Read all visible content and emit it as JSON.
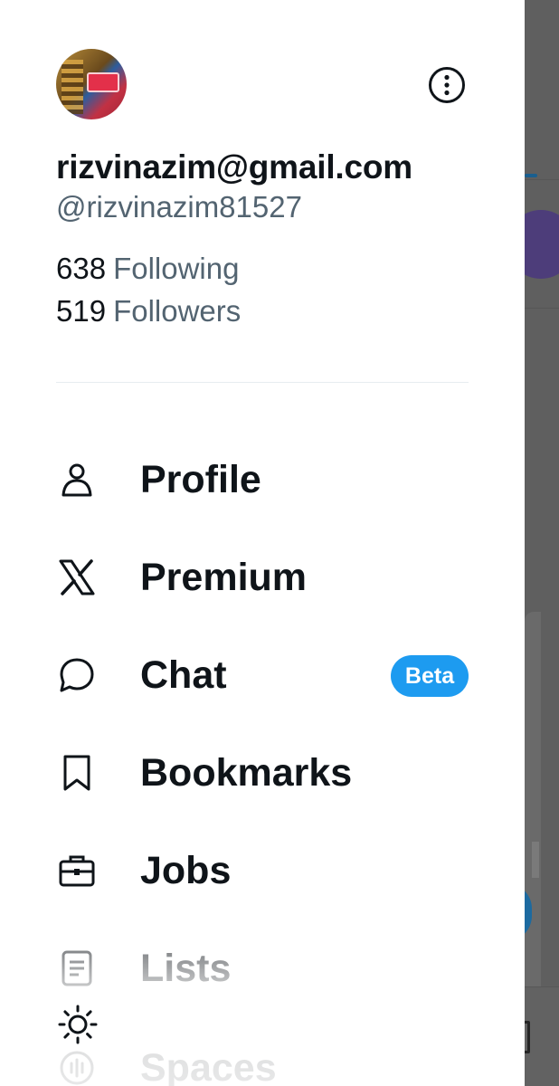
{
  "profile": {
    "display_name": "rizvinazim@gmail.com",
    "handle": "@rizvinazim81527",
    "following_count": "638",
    "following_label": "Following",
    "followers_count": "519",
    "followers_label": "Followers"
  },
  "nav": {
    "items": [
      {
        "label": "Profile",
        "icon": "person-icon"
      },
      {
        "label": "Premium",
        "icon": "x-logo-icon"
      },
      {
        "label": "Chat",
        "icon": "chat-bubble-icon",
        "badge": "Beta"
      },
      {
        "label": "Bookmarks",
        "icon": "bookmark-icon"
      },
      {
        "label": "Jobs",
        "icon": "briefcase-icon"
      },
      {
        "label": "Lists",
        "icon": "list-icon"
      },
      {
        "label": "Spaces",
        "icon": "spaces-icon"
      }
    ]
  },
  "controls": {
    "more_icon": "more-options-icon",
    "display_icon": "sun-icon"
  },
  "colors": {
    "text_primary": "#0f1419",
    "text_secondary": "#536471",
    "accent": "#1d9bf0",
    "divider": "#e7ecf0",
    "overlay": "#5f5f5f"
  }
}
